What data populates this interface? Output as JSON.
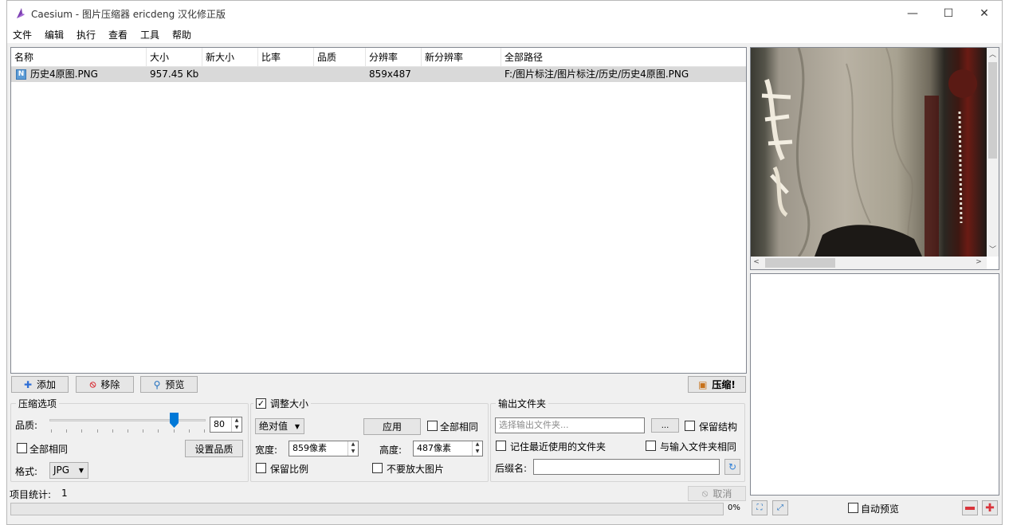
{
  "window": {
    "title": "Caesium - 图片压缩器 ericdeng 汉化修正版",
    "controls": {
      "minimize": "—",
      "maximize": "☐",
      "close": "✕"
    }
  },
  "menu": [
    "文件",
    "编辑",
    "执行",
    "查看",
    "工具",
    "帮助"
  ],
  "table": {
    "columns": [
      "名称",
      "大小",
      "新大小",
      "比率",
      "品质",
      "分辨率",
      "新分辨率",
      "全部路径"
    ],
    "rows": [
      {
        "icon": "N",
        "name": "历史4原图.PNG",
        "size": "957.45 Kb",
        "new_size": "",
        "ratio": "",
        "quality": "",
        "resolution": "859x487",
        "new_resolution": "",
        "path": "F:/图片标注/图片标注/历史/历史4原图.PNG"
      }
    ]
  },
  "actions": {
    "add": "添加",
    "remove": "移除",
    "preview": "预览",
    "compress": "压缩!"
  },
  "compression": {
    "group_title": "压缩选项",
    "quality_label": "品质:",
    "quality_value": "80",
    "quality_fraction": 0.8,
    "same_for_all": "全部相同",
    "set_quality": "设置品质",
    "format_label": "格式:",
    "format_value": "JPG"
  },
  "resize": {
    "group_title": "调整大小",
    "enabled": true,
    "mode": "绝对值",
    "apply": "应用",
    "same_for_all": "全部相同",
    "width_label": "宽度:",
    "width_value": "859像素",
    "height_label": "高度:",
    "height_value": "487像素",
    "keep_ratio": "保留比例",
    "no_enlarge": "不要放大图片"
  },
  "output": {
    "group_title": "输出文件夹",
    "placeholder": "选择输出文件夹...",
    "browse": "...",
    "keep_structure": "保留结构",
    "remember_last": "记住最近使用的文件夹",
    "same_as_input": "与输入文件夹相同",
    "suffix_label": "后缀名:",
    "suffix_value": ""
  },
  "status": {
    "items_label": "项目统计:",
    "items_count": "1",
    "cancel": "取消",
    "progress_text": "0%",
    "progress_fraction": 0
  },
  "preview": {
    "auto_preview": "自动预览"
  },
  "colors": {
    "accent": "#0078d7",
    "selection": "#d9d9d9",
    "minus": "#d9343b",
    "plus": "#d9343b"
  }
}
